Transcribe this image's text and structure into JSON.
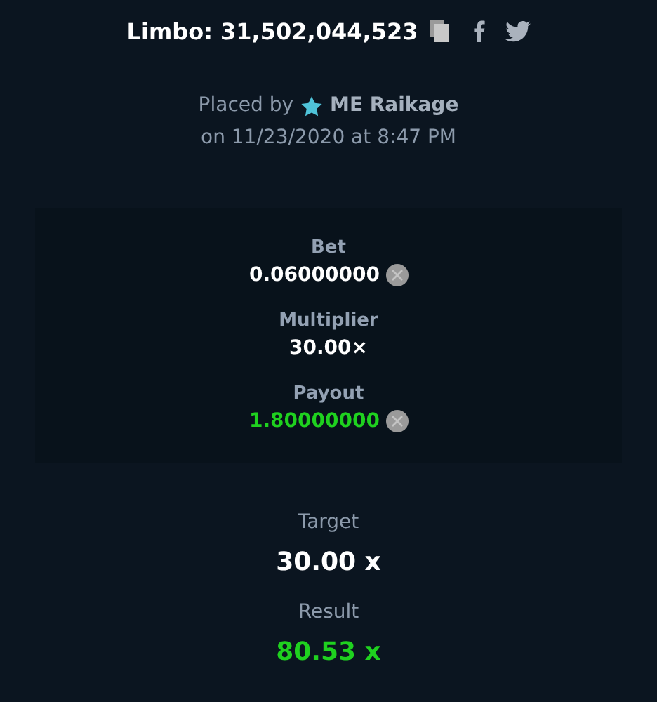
{
  "header": {
    "title": "Limbo: 31,502,044,523"
  },
  "placed": {
    "prefix": "Placed by",
    "user": "ME Raikage",
    "date": "on 11/23/2020 at 8:47 PM"
  },
  "stats": [
    {
      "label": "Bet",
      "value": "0.06000000",
      "kind": "amount",
      "win": false
    },
    {
      "label": "Multiplier",
      "value": "30.00×",
      "kind": "multiplier",
      "win": false
    },
    {
      "label": "Payout",
      "value": "1.80000000",
      "kind": "amount",
      "win": true
    }
  ],
  "results": [
    {
      "label": "Target",
      "value": "30.00 x",
      "win": false
    },
    {
      "label": "Result",
      "value": "80.53 x",
      "win": true
    }
  ]
}
